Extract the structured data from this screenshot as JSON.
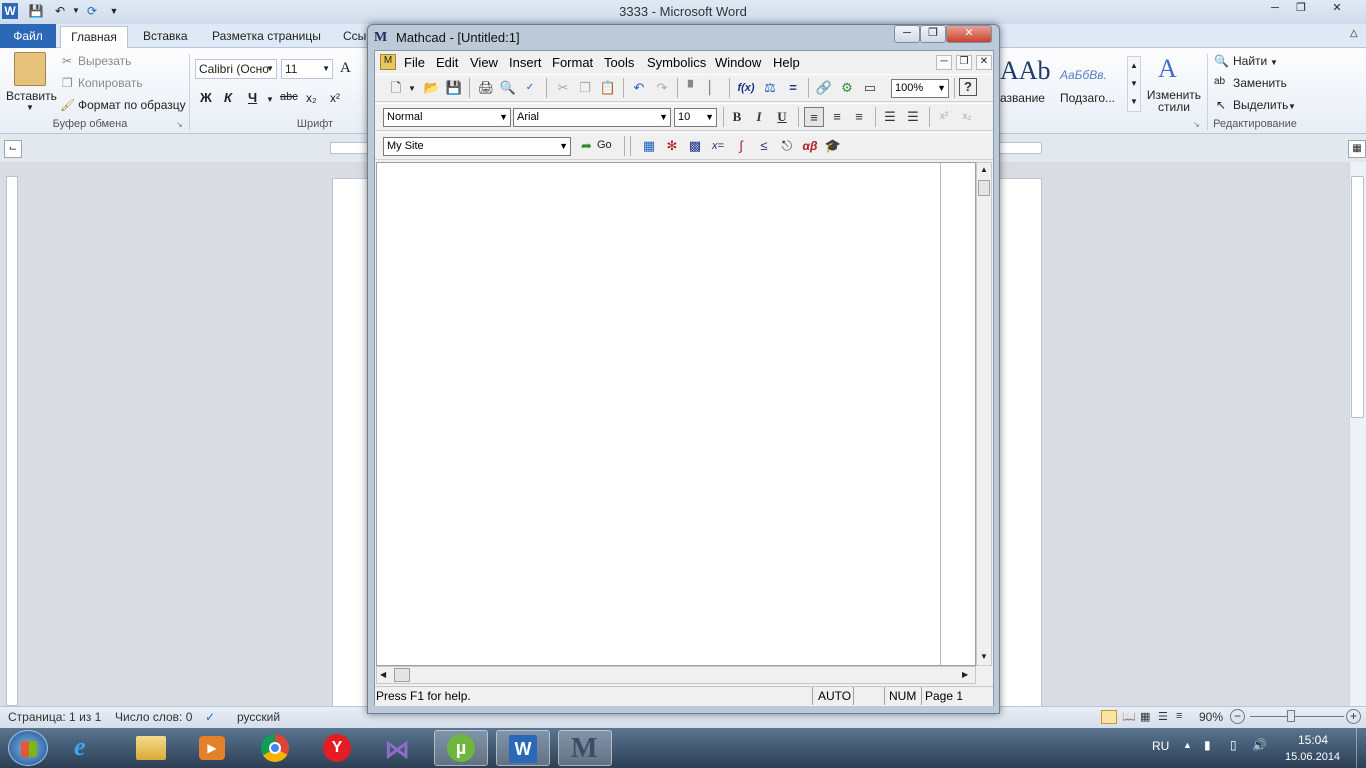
{
  "word": {
    "title": "3333  -  Microsoft Word",
    "tabs": {
      "file": "Файл",
      "home": "Главная",
      "insert": "Вставка",
      "layout": "Разметка страницы",
      "refs": "Ссы"
    },
    "clipboard": {
      "paste": "Вставить",
      "cut": "Вырезать",
      "copy": "Копировать",
      "format_painter": "Формат по образцу",
      "group": "Буфер обмена"
    },
    "font": {
      "name": "Calibri (Осно",
      "size": "11",
      "bold": "Ж",
      "italic": "К",
      "underline": "Ч",
      "strike": "abc",
      "sub": "x₂",
      "sup": "x²",
      "grow": "A",
      "group": "Шрифт"
    },
    "styles": {
      "sample1": "ААb",
      "label1": "азвание",
      "sample2": "АаБбВв.",
      "label2": "Подзаго...",
      "change": "Изменить стили"
    },
    "editing": {
      "find": "Найти",
      "replace": "Заменить",
      "select": "Выделить",
      "group": "Редактирование"
    },
    "status": {
      "page": "Страница: 1 из 1",
      "words": "Число слов: 0",
      "lang": "русский",
      "zoom": "90%"
    }
  },
  "mathcad": {
    "title": "Mathcad - [Untitled:1]",
    "menu": [
      "File",
      "Edit",
      "View",
      "Insert",
      "Format",
      "Tools",
      "Symbolics",
      "Window",
      "Help"
    ],
    "zoom": "100%",
    "style": "Normal",
    "font": "Arial",
    "size": "10",
    "site": "My Site",
    "go": "Go",
    "bold": "B",
    "italic": "I",
    "underline": "U",
    "status": {
      "help": "Press F1 for help.",
      "mode": "AUTO",
      "num": "NUM",
      "page": "Page 1"
    }
  },
  "taskbar": {
    "lang": "RU",
    "time": "15:04",
    "date": "15.06.2014"
  },
  "colors": {
    "word_blue": "#2b68b5",
    "taskbar": "#2b3f55"
  }
}
